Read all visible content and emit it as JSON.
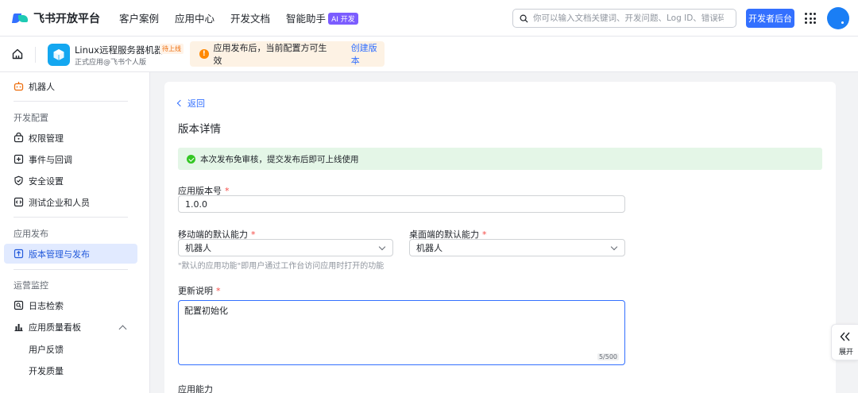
{
  "topnav": {
    "brand": "飞书开放平台",
    "links": [
      "客户案例",
      "应用中心",
      "开发文档",
      "智能助手"
    ],
    "ai_badge": "AI 开发",
    "search_placeholder": "你可以输入文档关键词、开发问题、Log ID、错误码",
    "dev_button": "开发者后台"
  },
  "subheader": {
    "app_name": "Linux远程服务器机器人",
    "app_status": "待上线",
    "app_subtitle": "正式应用@飞书个人版",
    "notice_text": "应用发布后，当前配置方可生效",
    "notice_link": "创建版本"
  },
  "sidebar": {
    "top_item": "机器人",
    "section_dev": "开发配置",
    "dev_items": [
      "权限管理",
      "事件与回调",
      "安全设置",
      "测试企业和人员"
    ],
    "section_publish": "应用发布",
    "publish_item": "版本管理与发布",
    "section_ops": "运营监控",
    "ops_items": [
      "日志检索",
      "应用质量看板"
    ],
    "ops_sub_items": [
      "用户反馈",
      "开发质量"
    ]
  },
  "main": {
    "back": "返回",
    "title": "版本详情",
    "success_text": "本次发布免审核，提交发布后即可上线使用",
    "version_label": "应用版本号",
    "version_value": "1.0.0",
    "mobile_label": "移动端的默认能力",
    "mobile_value": "机器人",
    "desktop_label": "桌面端的默认能力",
    "desktop_value": "机器人",
    "ability_hint": "\"默认的应用功能\"即用户通过工作台访问应用时打开的功能",
    "notes_label": "更新说明",
    "notes_value": "配置初始化",
    "notes_counter": "5/500",
    "capabilities_label": "应用能力",
    "required_mark": "*"
  },
  "expand_label": "展开",
  "colors": {
    "accent": "#3370ff",
    "active_bg": "#e1eaff",
    "success_bg": "#e4f6e7",
    "notice_bg": "#fdf2e4",
    "required": "#f54a45"
  }
}
